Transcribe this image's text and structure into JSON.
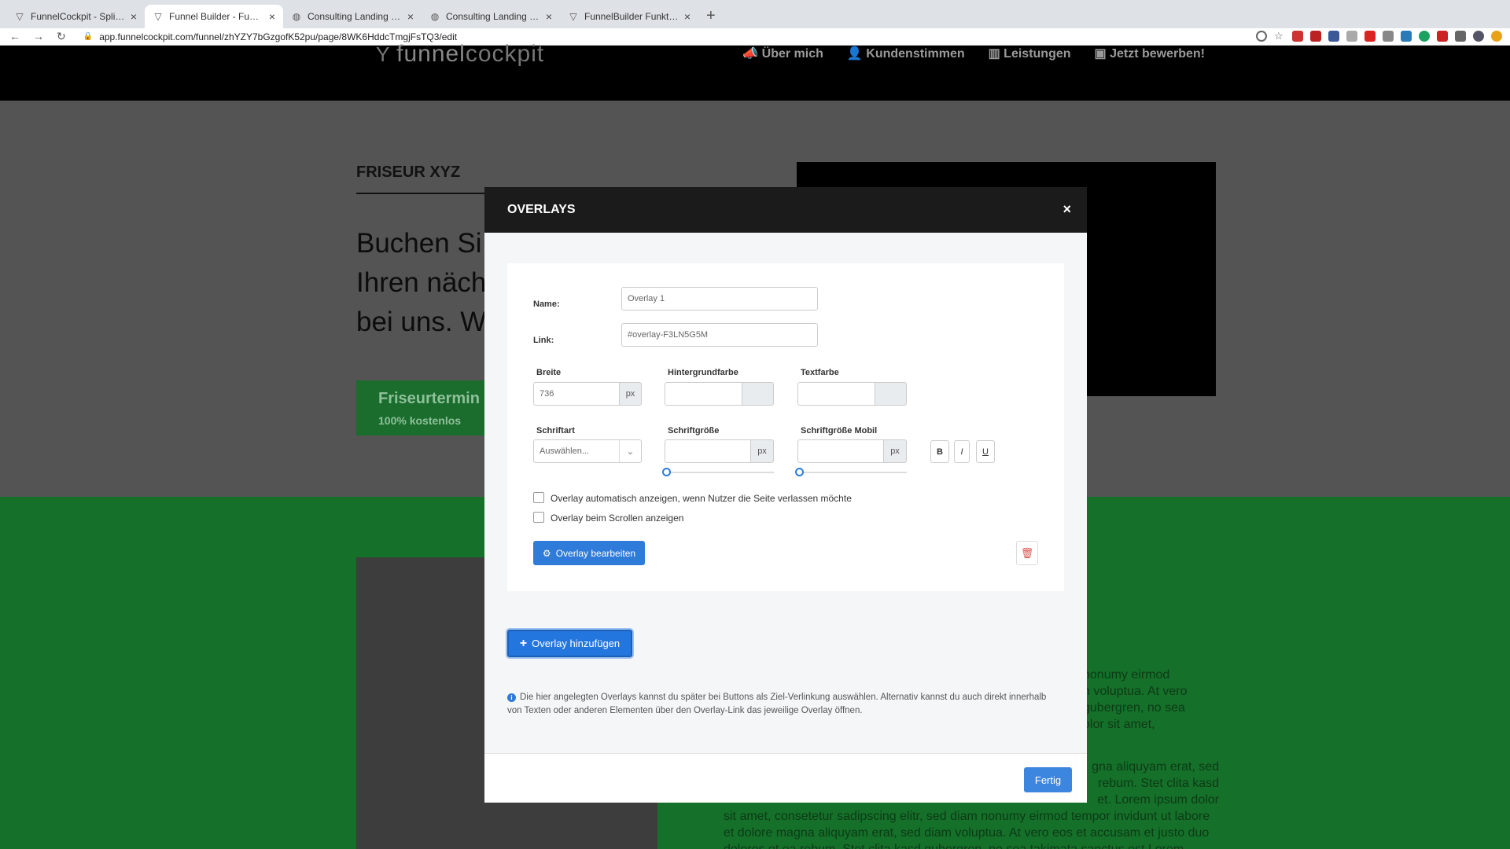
{
  "browser": {
    "tabs": [
      {
        "title": "FunnelCockpit - Splittests, Ma..."
      },
      {
        "title": "Funnel Builder - FunnelCockpit"
      },
      {
        "title": "Consulting Landing Page"
      },
      {
        "title": "Consulting Landing Page"
      },
      {
        "title": "FunnelBuilder Funktionen & El..."
      }
    ],
    "url": "app.funnelcockpit.com/funnel/zhYZY7bGzgofK52pu/page/8WK6HddcTmgjFsTQ3/edit"
  },
  "site": {
    "logo_prefix": "funnel",
    "logo_suffix": "cockpit",
    "nav": [
      "Über mich",
      "Kundenstimmen",
      "Leistungen",
      "Jetzt bewerben!"
    ],
    "subtitle": "FRISEUR XYZ",
    "headline": [
      "Buchen Si",
      "Ihren näch",
      "bei uns. W"
    ],
    "cta_title": "Friseurtermin",
    "cta_sub": "100% kostenlos",
    "lorem_right": "nonumy eirmod\nn voluptua. At vero\ngubergren, no sea\nolor sit amet,",
    "lorem_bottom": [
      "gna aliquyam erat, sed",
      "rebum. Stet clita kasd",
      "et. Lorem ipsum dolor",
      "sit amet, consetetur sadipscing elitr, sed diam nonumy eirmod tempor invidunt ut labore",
      "et dolore magna aliquyam erat, sed diam voluptua. At vero eos et accusam et justo duo",
      "dolores et ea rebum. Stet clita kasd gubergren, no sea takimata sanctus est Lorem"
    ]
  },
  "modal": {
    "title": "OVERLAYS",
    "close": "×",
    "name_label": "Name:",
    "name_value": "Overlay 1",
    "link_label": "Link:",
    "link_value": "#overlay-F3LN5G5M",
    "breite_label": "Breite",
    "breite_value": "736",
    "px": "px",
    "bg_label": "Hintergrundfarbe",
    "text_label": "Textfarbe",
    "font_label": "Schriftart",
    "font_placeholder": "Auswählen...",
    "size_label": "Schriftgröße",
    "size_mobile_label": "Schriftgröße Mobil",
    "bold": "B",
    "italic": "I",
    "underline": "U",
    "check1": "Overlay automatisch anzeigen, wenn Nutzer die Seite verlassen möchte",
    "check2": "Overlay beim Scrollen anzeigen",
    "edit_button": "Overlay bearbeiten",
    "add_button": "Overlay hinzufügen",
    "info": "Die hier angelegten Overlays kannst du später bei Buttons als Ziel-Verlinkung auswählen. Alternativ kannst du auch direkt innerhalb von Texten oder anderen Elementen über den Overlay-Link das jeweilige Overlay öffnen.",
    "done_button": "Fertig"
  }
}
